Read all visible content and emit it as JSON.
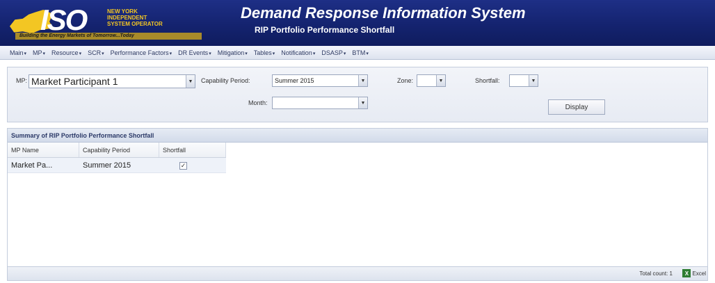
{
  "header": {
    "logo_text": "ISO",
    "logo_lines": [
      "NEW YORK",
      "INDEPENDENT",
      "SYSTEM OPERATOR"
    ],
    "logo_tagline": "Building the Energy Markets of Tomorrow...Today",
    "app_title": "Demand Response Information System",
    "page_subtitle": "RIP Portfolio Performance Shortfall"
  },
  "menu": {
    "items": [
      "Main",
      "MP",
      "Resource",
      "SCR",
      "Performance Factors",
      "DR Events",
      "Mitigation",
      "Tables",
      "Notification",
      "DSASP",
      "BTM"
    ]
  },
  "filters": {
    "mp_label": "MP:",
    "mp_value": "Market Participant 1",
    "capability_period_label": "Capability Period:",
    "capability_period_value": "Summer 2015",
    "zone_label": "Zone:",
    "zone_value": "",
    "shortfall_label": "Shortfall:",
    "shortfall_value": "",
    "month_label": "Month:",
    "month_value": "",
    "display_button": "Display"
  },
  "grid": {
    "title": "Summary of RIP Portfolio Performance Shortfall",
    "columns": [
      "MP Name",
      "Capability Period",
      "Shortfall"
    ],
    "rows": [
      {
        "mp_name": "Market Pa...",
        "capability_period": "Summer 2015",
        "shortfall_checked": true
      }
    ],
    "total_count": "Total count: 1",
    "export_label": "Excel"
  },
  "colors": {
    "header_blue": "#14236f",
    "logo_gold": "#f3c623"
  }
}
